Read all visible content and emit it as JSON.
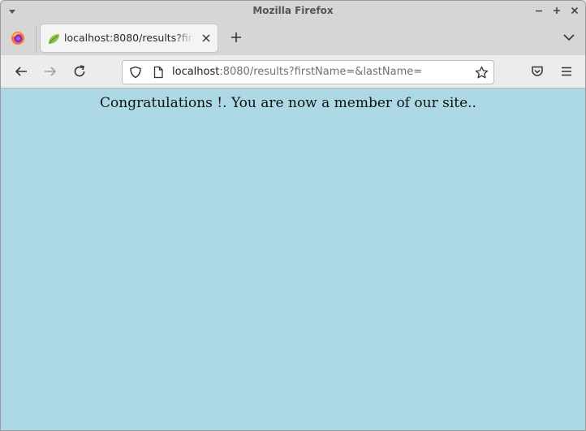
{
  "window": {
    "title": "Mozilla Firefox"
  },
  "tab": {
    "label": "localhost:8080/results?firstName=&lastName=",
    "favicon": "spring-leaf-icon"
  },
  "urlbar": {
    "host": "localhost",
    "rest": ":8080/results?firstName=&lastName="
  },
  "page": {
    "background": "#add8e6",
    "message": "Congratulations !. You are now a member of our site.."
  },
  "icons": [
    "menu-icon",
    "minimize-icon",
    "maximize-icon",
    "close-icon",
    "firefox-logo-icon",
    "spring-leaf-icon",
    "tab-close-icon",
    "new-tab-icon",
    "tab-list-icon",
    "back-icon",
    "forward-icon",
    "reload-icon",
    "shield-icon",
    "page-icon",
    "star-icon",
    "pocket-icon",
    "hamburger-menu-icon"
  ]
}
